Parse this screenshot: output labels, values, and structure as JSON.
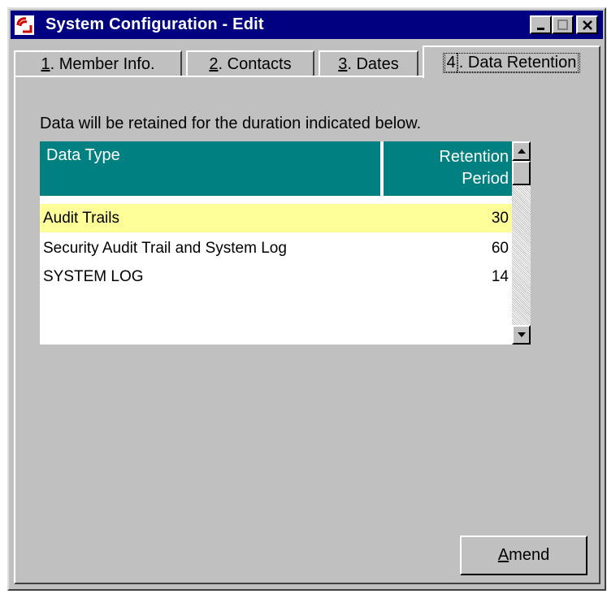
{
  "window": {
    "title": "System Configuration - Edit",
    "app_icon": "app-logo-icon",
    "controls": [
      "minimize-icon",
      "maximize-icon",
      "close-icon"
    ]
  },
  "tabs": [
    {
      "mnemonic": "1",
      "label": ". Member Info.",
      "active": false
    },
    {
      "mnemonic": "2",
      "label": ". Contacts",
      "active": false
    },
    {
      "mnemonic": "3",
      "label": ". Dates",
      "active": false
    },
    {
      "mnemonic": "4",
      "label": ". Data Retention",
      "active": true
    }
  ],
  "panel": {
    "description": "Data will be retained for the duration indicated below."
  },
  "table": {
    "columns": [
      "Data Type",
      "Retention",
      "Period"
    ],
    "rows": [
      {
        "type": "Audit Trails",
        "period": "30",
        "selected": true
      },
      {
        "type": "Security Audit Trail and System Log",
        "period": "60",
        "selected": false
      },
      {
        "type": "SYSTEM LOG",
        "period": "14",
        "selected": false
      }
    ]
  },
  "buttons": {
    "amend_mnemonic": "A",
    "amend_rest": "mend"
  },
  "colors": {
    "titlebar": "#000080",
    "header": "#008080",
    "selected_row": "#ffff99",
    "face": "#c0c0c0"
  }
}
